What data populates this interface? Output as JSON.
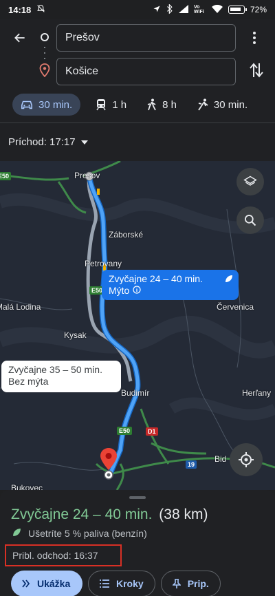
{
  "status_bar": {
    "time": "14:18",
    "network_label": "Vo WiFi",
    "battery": "72%"
  },
  "route_header": {
    "origin": "Prešov",
    "destination": "Košice"
  },
  "travel_modes": [
    {
      "name": "car",
      "icon": "car-icon",
      "duration": "30 min.",
      "active": true
    },
    {
      "name": "transit",
      "icon": "train-icon",
      "duration": "1 h",
      "active": false
    },
    {
      "name": "walk",
      "icon": "walk-icon",
      "duration": "8 h",
      "active": false
    },
    {
      "name": "ride",
      "icon": "ride-icon",
      "duration": "30 min.",
      "active": false
    }
  ],
  "arrival": {
    "label": "Príchod: 17:17"
  },
  "map": {
    "places": [
      "Prešov",
      "Záborské",
      "Petrovany",
      "Malá Lodina",
      "Červenica",
      "Kysak",
      "Budimír",
      "Herľany",
      "Bukovec",
      "Bid"
    ],
    "road_shields": [
      "E50",
      "E50",
      "E50",
      "D1",
      "19"
    ],
    "selected_route": {
      "line1": "Zvyčajne 24 – 40 min.",
      "line2": "Mýto"
    },
    "alternative_route": {
      "line1": "Zvyčajne 35 – 50 min.",
      "line2": "Bez mýta"
    }
  },
  "sheet": {
    "duration": "Zvyčajne 24 – 40 min.",
    "distance": "(38 km)",
    "fuel_note": "Ušetríte 5 % paliva (benzín)",
    "departure": "Pribl. odchod: 16:37",
    "actions": {
      "preview": "Ukážka",
      "steps": "Kroky",
      "pin": "Prip."
    }
  },
  "colors": {
    "route_blue": "#4fa3f7",
    "route_alt": "#9aa4b1",
    "road_green": "#3f8a4a",
    "accent_green": "#81c995",
    "highlight_red": "#d93025"
  }
}
